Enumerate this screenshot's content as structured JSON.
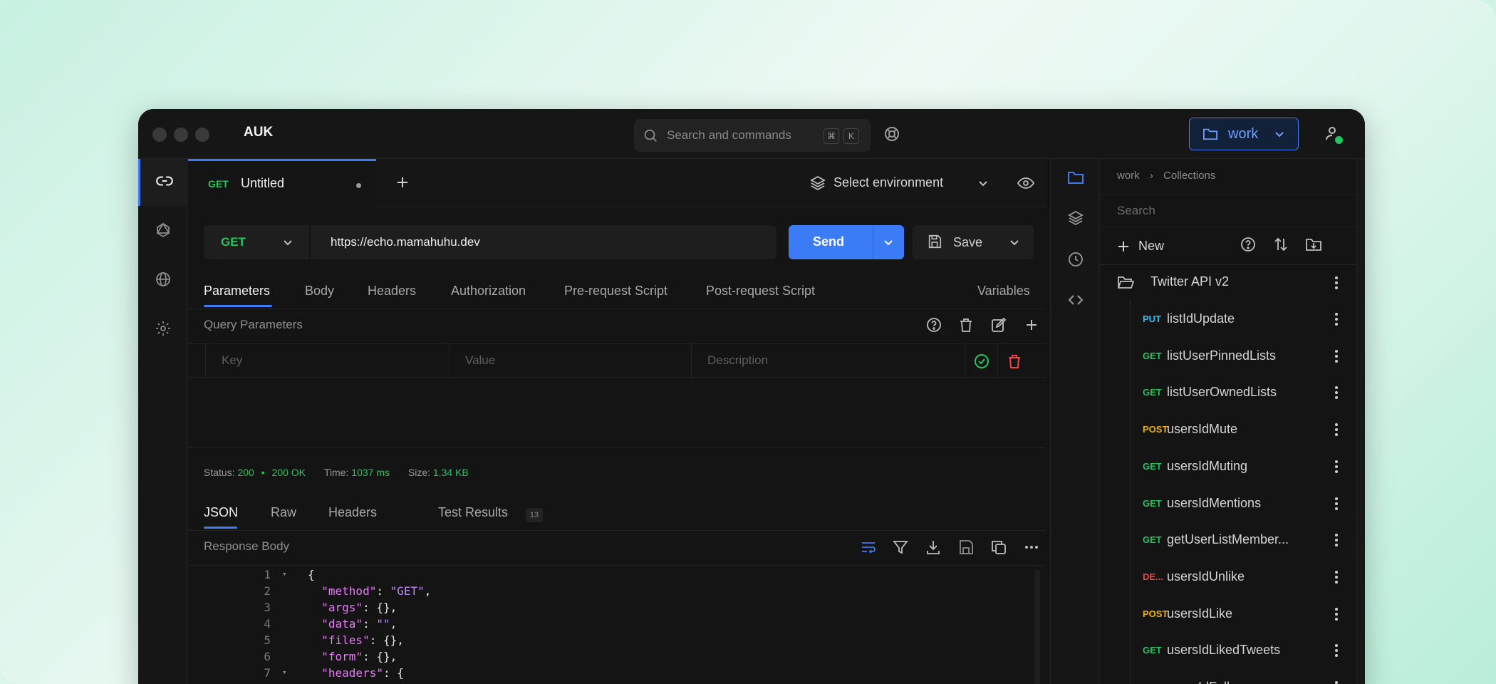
{
  "app": {
    "name": "AUK"
  },
  "search": {
    "placeholder": "Search and commands",
    "shortcut_1": "⌘",
    "shortcut_2": "K"
  },
  "workspace": {
    "label": "work"
  },
  "request_tab": {
    "method": "GET",
    "title": "Untitled"
  },
  "environment": {
    "label": "Select environment"
  },
  "request": {
    "method": "GET",
    "url": "https://echo.mamahuhu.dev",
    "send_label": "Send",
    "save_label": "Save"
  },
  "request_sections": {
    "tabs": [
      "Parameters",
      "Body",
      "Headers",
      "Authorization",
      "Pre-request Script",
      "Post-request Script"
    ],
    "variables": "Variables"
  },
  "query_params": {
    "title": "Query Parameters",
    "key_placeholder": "Key",
    "value_placeholder": "Value",
    "description_placeholder": "Description"
  },
  "response": {
    "status_label": "Status:",
    "status_code": "200",
    "status_sep": "•",
    "status_text": "200 OK",
    "time_label": "Time:",
    "time_value": "1037 ms",
    "size_label": "Size:",
    "size_value": "1.34 KB",
    "tabs": [
      "JSON",
      "Raw",
      "Headers",
      "Test Results"
    ],
    "headers_count": "13",
    "body_title": "Response Body"
  },
  "code_lines": [
    {
      "n": "1",
      "fold": "▾",
      "indent": "",
      "key": "",
      "sep": "",
      "val": "",
      "plain": "{"
    },
    {
      "n": "2",
      "fold": "",
      "indent": "  ",
      "key": "\"method\"",
      "sep": ": ",
      "val": "\"GET\"",
      "plain": ","
    },
    {
      "n": "3",
      "fold": "",
      "indent": "  ",
      "key": "\"args\"",
      "sep": ": ",
      "val": "",
      "plain": "{},"
    },
    {
      "n": "4",
      "fold": "",
      "indent": "  ",
      "key": "\"data\"",
      "sep": ": ",
      "val": "\"\"",
      "plain": ","
    },
    {
      "n": "5",
      "fold": "",
      "indent": "  ",
      "key": "\"files\"",
      "sep": ": ",
      "val": "",
      "plain": "{},"
    },
    {
      "n": "6",
      "fold": "",
      "indent": "  ",
      "key": "\"form\"",
      "sep": ": ",
      "val": "",
      "plain": "{},"
    },
    {
      "n": "7",
      "fold": "▾",
      "indent": "  ",
      "key": "\"headers\"",
      "sep": ": ",
      "val": "",
      "plain": "{"
    }
  ],
  "collections": {
    "breadcrumb": [
      "work",
      "Collections"
    ],
    "search_placeholder": "Search",
    "new_label": "New",
    "folder": "Twitter API v2",
    "requests": [
      {
        "method": "PUT",
        "color": "#38bdf8",
        "name": "listIdUpdate"
      },
      {
        "method": "GET",
        "color": "#22c55e",
        "name": "listUserPinnedLists"
      },
      {
        "method": "GET",
        "color": "#22c55e",
        "name": "listUserOwnedLists"
      },
      {
        "method": "POST",
        "color": "#eab308",
        "name": "usersIdMute"
      },
      {
        "method": "GET",
        "color": "#22c55e",
        "name": "usersIdMuting"
      },
      {
        "method": "GET",
        "color": "#22c55e",
        "name": "usersIdMentions"
      },
      {
        "method": "GET",
        "color": "#22c55e",
        "name": "getUserListMember..."
      },
      {
        "method": "DE...",
        "color": "#ef4444",
        "name": "usersIdUnlike"
      },
      {
        "method": "POST",
        "color": "#eab308",
        "name": "usersIdLike"
      },
      {
        "method": "GET",
        "color": "#22c55e",
        "name": "usersIdLikedTweets"
      },
      {
        "method": "POST",
        "color": "#eab308",
        "name": "usersIdFollow"
      }
    ]
  },
  "colors": {
    "accent": "#3f7bf0",
    "get": "#22c55e",
    "post": "#eab308",
    "put": "#38bdf8",
    "delete": "#ef4444",
    "json_key": "#e879f9"
  }
}
